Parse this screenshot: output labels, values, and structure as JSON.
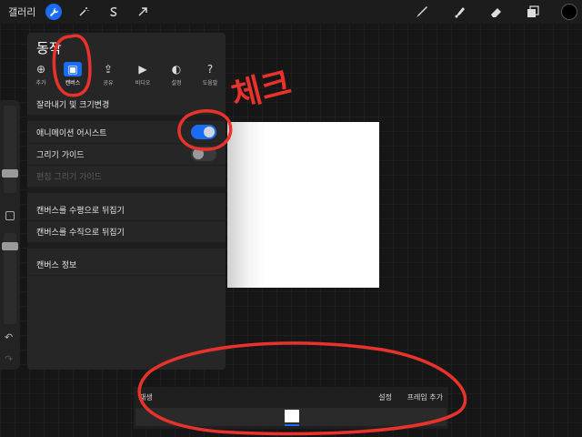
{
  "topbar": {
    "gallery_label": "갤러리",
    "left_tools": [
      {
        "icon": "wrench-icon",
        "active": true
      },
      {
        "icon": "magic-wand-icon",
        "active": false
      },
      {
        "icon": "selection-s-icon",
        "active": false
      },
      {
        "icon": "arrow-transform-icon",
        "active": false
      }
    ],
    "right_tools": [
      "brush-icon",
      "smudge-icon",
      "eraser-icon",
      "layers-icon"
    ],
    "current_color": "#000000"
  },
  "panel": {
    "title": "동작",
    "tabs": [
      {
        "label": "추가",
        "icon": "add-icon",
        "glyph": "⊕"
      },
      {
        "label": "캔버스",
        "icon": "canvas-icon",
        "glyph": "▣",
        "active": true
      },
      {
        "label": "공유",
        "icon": "share-icon",
        "glyph": "⇪"
      },
      {
        "label": "비디오",
        "icon": "play-icon",
        "glyph": "▶"
      },
      {
        "label": "설정",
        "icon": "toggle-icon",
        "glyph": "◐"
      },
      {
        "label": "도움말",
        "icon": "help-icon",
        "glyph": "?"
      }
    ],
    "rows": {
      "crop": "잘라내기 및 크기변경",
      "anim_assist": "애니메이션 어시스트",
      "drawing_guide": "그리기 가이드",
      "edit_guide": "편집 그리기 가이드",
      "flip_h": "캔버스를 수평으로 뒤집기",
      "flip_v": "캔버스를 수직으로 뒤집기",
      "canvas_info": "캔버스 정보"
    },
    "toggles": {
      "anim_assist": true,
      "drawing_guide": false
    }
  },
  "anim_bar": {
    "play_label": "재생",
    "settings_label": "설정",
    "add_frame_label": "프레임 추가"
  },
  "annotation_text": "체크",
  "annotation_color": "#e8322c",
  "accent_color": "#1a6cf5"
}
